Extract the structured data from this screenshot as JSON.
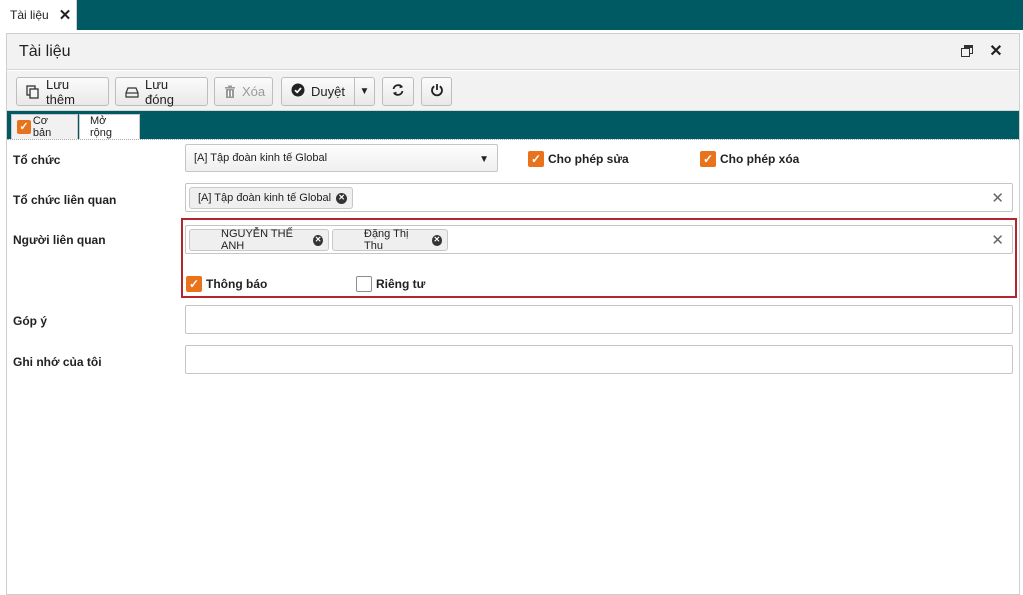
{
  "doc_tab": {
    "label": "Tài liệu",
    "close": "✕"
  },
  "panel": {
    "title": "Tài liệu",
    "close": "✕"
  },
  "toolbar": {
    "save_new": "Lưu thêm",
    "save_close": "Lưu đóng",
    "delete": "Xóa",
    "approve": "Duyệt",
    "caret": "▼"
  },
  "tabs": [
    {
      "label": "Cơ bản",
      "checked": true
    },
    {
      "label": "Mở rộng",
      "checked": false
    }
  ],
  "form": {
    "org": {
      "label": "Tổ chức",
      "value": "[A] Tập đoàn kinh tế Global",
      "arrow": "▼"
    },
    "allow_edit": {
      "label": "Cho phép sửa",
      "checked": true
    },
    "allow_delete": {
      "label": "Cho phép xóa",
      "checked": true
    },
    "related_org": {
      "label": "Tổ chức liên quan",
      "tags": [
        "[A] Tập đoàn kinh tế Global"
      ],
      "clear": "✕"
    },
    "related_people": {
      "label": "Người liên quan",
      "tags": [
        "NGUYỄN THẾ ANH",
        "Đặng Thị Thu"
      ],
      "clear": "✕"
    },
    "notify": {
      "label": "Thông báo",
      "checked": true
    },
    "private": {
      "label": "Riêng tư",
      "checked": false
    },
    "feedback": {
      "label": "Góp ý",
      "value": ""
    },
    "my_notes": {
      "label": "Ghi nhớ của tôi",
      "value": ""
    }
  },
  "colors": {
    "brand": "#005a63",
    "accent": "#e8731c",
    "highlight": "#b3262d"
  },
  "icons": [
    "close-icon",
    "restore-window-icon",
    "copy-icon",
    "save-icon",
    "trash-icon",
    "check-circle-icon",
    "refresh-icon",
    "power-icon",
    "checkmark-icon",
    "remove-tag-icon"
  ]
}
